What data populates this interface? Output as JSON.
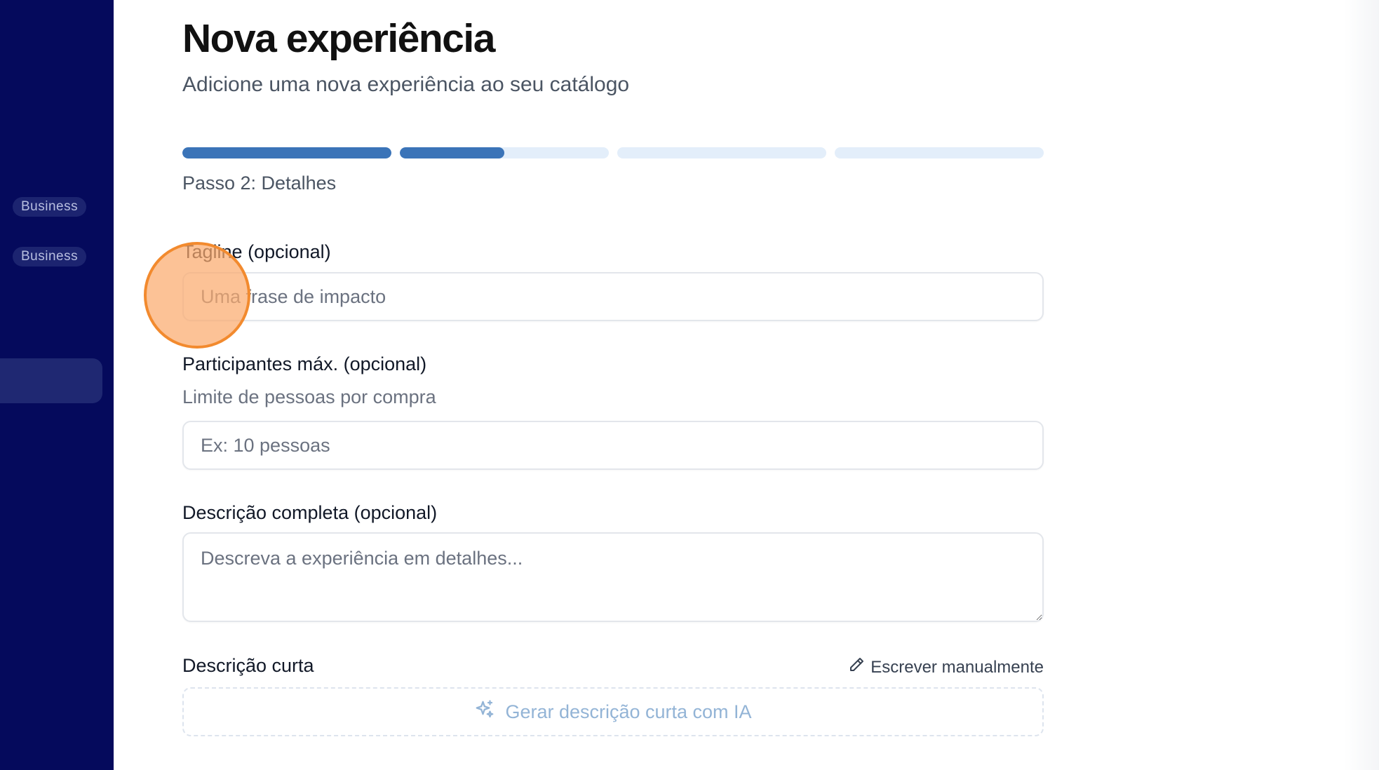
{
  "sidebar": {
    "badges": [
      "Business",
      "Business"
    ]
  },
  "header": {
    "title": "Nova experiência",
    "subtitle": "Adicione uma nova experiência ao seu catálogo"
  },
  "progress": {
    "total_steps": 4,
    "current_step": 2,
    "step_fills": [
      1,
      0.5,
      0,
      0
    ],
    "step_label": "Passo 2: Detalhes",
    "accent_color": "#3b74b8",
    "track_color": "#e3eefa"
  },
  "form": {
    "tagline": {
      "label": "Tagline (opcional)",
      "placeholder": "Uma frase de impacto"
    },
    "max_participants": {
      "label": "Participantes máx. (opcional)",
      "help": "Limite de pessoas por compra",
      "placeholder": "Ex: 10 pessoas"
    },
    "full_description": {
      "label": "Descrição completa (opcional)",
      "placeholder": "Descreva a experiência em detalhes..."
    },
    "short_description": {
      "label": "Descrição curta",
      "manual_link": "Escrever manualmente",
      "ai_button": "Gerar descrição curta com IA"
    }
  },
  "colors": {
    "sidebar_bg": "#050a5c",
    "cursor_highlight": "#f28a2e"
  }
}
